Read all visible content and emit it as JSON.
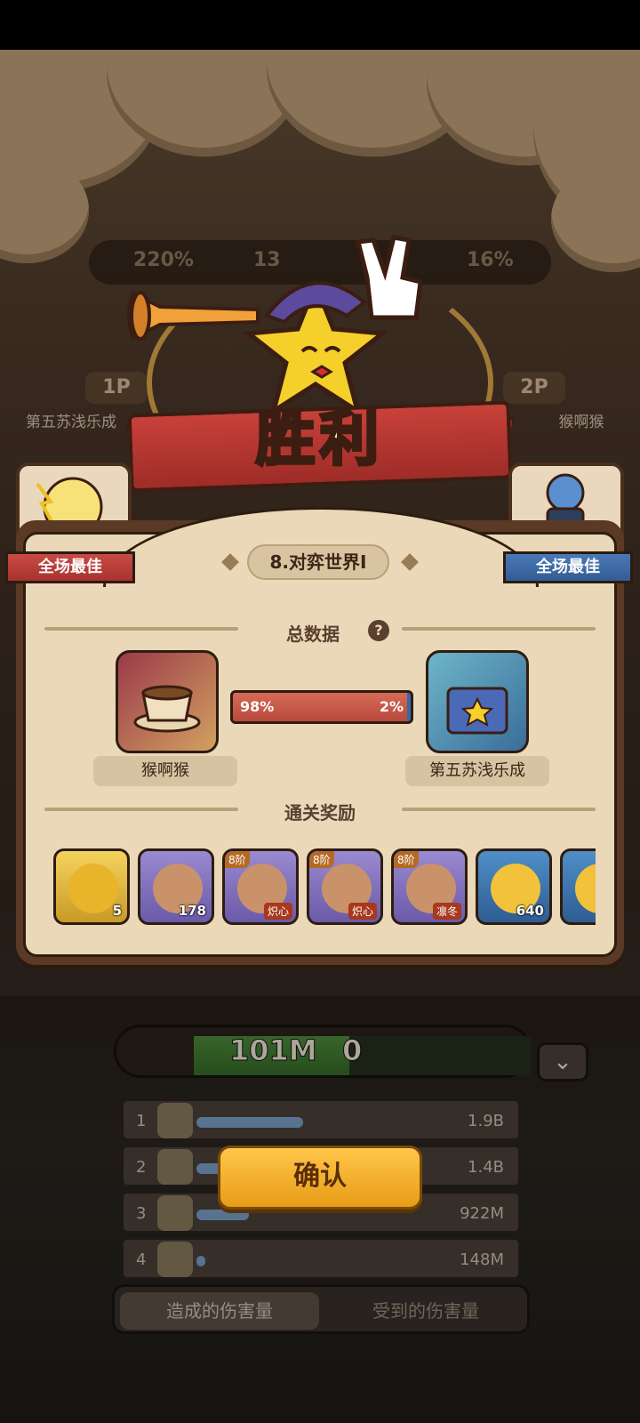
{
  "background": {
    "left_player": {
      "badge": "1P",
      "name": "第五苏浅乐成"
    },
    "right_player": {
      "badge": "2P",
      "name": "猴啊猴"
    },
    "stats": {
      "left": "220%",
      "right": "16%",
      "middle": "13"
    }
  },
  "result": {
    "title": "胜利"
  },
  "best": {
    "left_label": "全场最佳",
    "right_label": "全场最佳"
  },
  "stage": {
    "name": "8.对弈世界I"
  },
  "totals": {
    "title": "总数据",
    "left_name": "猴啊猴",
    "right_name": "第五苏浅乐成",
    "left_percent": "98%",
    "right_percent": "2%",
    "left_share": 0.98
  },
  "rewards": {
    "title": "通关奖励",
    "items": [
      {
        "icon": "gold-pinwheel-icon",
        "qty": "5",
        "tier": "",
        "tag": ""
      },
      {
        "icon": "scroll-book-icon",
        "qty": "178",
        "tier": "",
        "tag": ""
      },
      {
        "icon": "armor-chest-icon",
        "qty": "",
        "tier": "8阶",
        "tag": "炽心"
      },
      {
        "icon": "gauntlet-icon",
        "qty": "",
        "tier": "8阶",
        "tag": "炽心"
      },
      {
        "icon": "cloak-icon",
        "qty": "",
        "tier": "8阶",
        "tag": "凛冬"
      },
      {
        "icon": "spade-coin-icon",
        "qty": "640",
        "tier": "",
        "tag": ""
      },
      {
        "icon": "coin-icon",
        "qty": "",
        "tier": "",
        "tag": ""
      }
    ]
  },
  "damage": {
    "left_total": "101M",
    "right_total": "0",
    "left_share": 0.46,
    "rows": [
      {
        "rank": "1",
        "value": "1.9B",
        "share": 1.0
      },
      {
        "rank": "2",
        "value": "1.4B",
        "share": 0.74
      },
      {
        "rank": "3",
        "value": "922M",
        "share": 0.49
      },
      {
        "rank": "4",
        "value": "148M",
        "share": 0.08
      }
    ],
    "tabs": {
      "dealt": "造成的伤害量",
      "taken": "受到的伤害量"
    }
  },
  "buttons": {
    "confirm": "确认"
  },
  "colors": {
    "accent": "#e89c16",
    "red": "#b84a3c",
    "blue": "#3b67a8"
  }
}
